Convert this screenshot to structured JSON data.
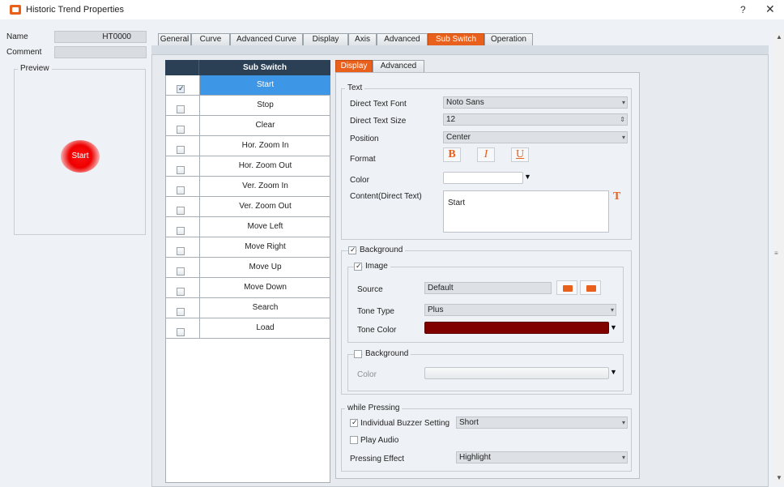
{
  "window": {
    "title": "Historic Trend Properties",
    "help": "?",
    "close": "✕"
  },
  "left": {
    "name_label": "Name",
    "name_value": "HT0000",
    "comment_label": "Comment",
    "preview_label": "Preview",
    "preview_button_text": "Start"
  },
  "tabs": [
    "General",
    "Curve",
    "Advanced Curve",
    "Display",
    "Axis",
    "Advanced",
    "Sub Switch",
    "Operation"
  ],
  "sub_switch": {
    "header": "Sub Switch",
    "items": [
      {
        "label": "Start",
        "checked": true
      },
      {
        "label": "Stop",
        "checked": false
      },
      {
        "label": "Clear",
        "checked": false
      },
      {
        "label": "Hor. Zoom In",
        "checked": false
      },
      {
        "label": "Hor. Zoom Out",
        "checked": false
      },
      {
        "label": "Ver. Zoom In",
        "checked": false
      },
      {
        "label": "Ver. Zoom Out",
        "checked": false
      },
      {
        "label": "Move Left",
        "checked": false
      },
      {
        "label": "Move Right",
        "checked": false
      },
      {
        "label": "Move Up",
        "checked": false
      },
      {
        "label": "Move Down",
        "checked": false
      },
      {
        "label": "Search",
        "checked": false
      },
      {
        "label": "Load",
        "checked": false
      }
    ]
  },
  "detail_tabs": [
    "Display",
    "Advanced"
  ],
  "text_group": {
    "title": "Text",
    "font_label": "Direct Text Font",
    "font_value": "Noto Sans",
    "size_label": "Direct Text Size",
    "size_value": "12",
    "position_label": "Position",
    "position_value": "Center",
    "format_label": "Format",
    "format_bold": "B",
    "format_italic": "I",
    "format_underline": "U",
    "color_label": "Color",
    "content_label": "Content(Direct Text)",
    "content_value": "Start",
    "text_icon": "T"
  },
  "background_group": {
    "title": "Background",
    "image_title": "Image",
    "source_label": "Source",
    "source_value": "Default",
    "tone_type_label": "Tone Type",
    "tone_type_value": "Plus",
    "tone_color_label": "Tone Color",
    "tone_color_hex": "#800000",
    "bg_title": "Background",
    "bg_color_label": "Color"
  },
  "pressing_group": {
    "title": "while Pressing",
    "buzzer_label": "Individual Buzzer Setting",
    "buzzer_value": "Short",
    "play_audio_label": "Play Audio",
    "effect_label": "Pressing Effect",
    "effect_value": "Highlight"
  },
  "colors": {
    "accent": "#e8601c",
    "header": "#2b3f55",
    "selected": "#3d96e6"
  }
}
